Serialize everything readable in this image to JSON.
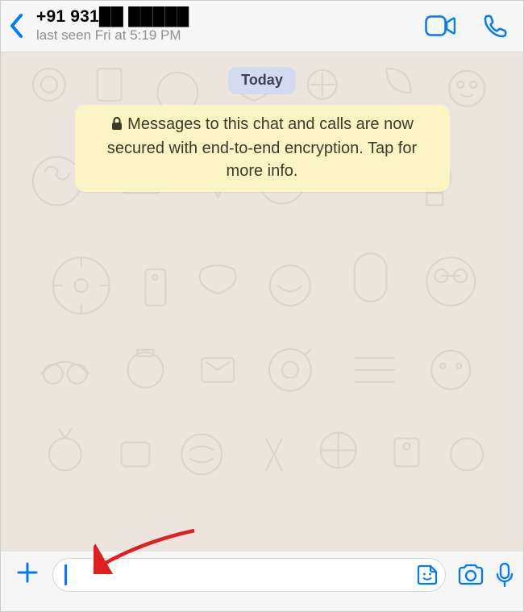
{
  "header": {
    "contact_name": "+91 931██ █████",
    "last_seen": "last seen Fri at 5:19 PM"
  },
  "chat": {
    "date_chip": "Today",
    "encryption_notice": "Messages to this chat and calls are now secured with end-to-end encryption. Tap for more info."
  },
  "input": {
    "value": "",
    "placeholder": ""
  },
  "colors": {
    "accent": "#007aff",
    "chat_bg": "#ece5dd",
    "notice_bg": "#fdf4c5",
    "date_chip_bg": "#d4dbf0"
  }
}
